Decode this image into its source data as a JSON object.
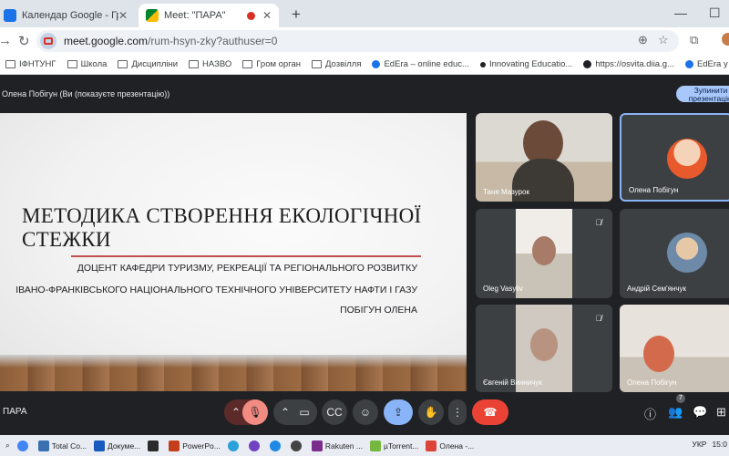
{
  "browser": {
    "tabs": [
      {
        "title": "Календар Google - Графік по",
        "active": false
      },
      {
        "title": "Meet: \"ПАРА\"",
        "active": true
      }
    ],
    "url_domain": "meet.google.com",
    "url_path": "/rum-hsyn-zky?authuser=0",
    "bookmarks": [
      {
        "label": "ІФНТУНГ",
        "type": "folder"
      },
      {
        "label": "Школа",
        "type": "folder"
      },
      {
        "label": "Дисципліни",
        "type": "folder"
      },
      {
        "label": "НАЗВО",
        "type": "folder"
      },
      {
        "label": "Гром орган",
        "type": "folder"
      },
      {
        "label": "Дозвілля",
        "type": "folder"
      },
      {
        "label": "EdEra – online educ...",
        "type": "site",
        "color": "#1a73e8"
      },
      {
        "label": "Innovating Educatio...",
        "type": "site",
        "color": "#202124"
      },
      {
        "label": "https://osvita.diia.g...",
        "type": "site",
        "color": "#202124"
      },
      {
        "label": "EdEra у Viber",
        "type": "site",
        "color": "#1a73e8"
      }
    ]
  },
  "meet": {
    "presenting_label": "Олена Побігун (Ви (показуєте презентацію))",
    "stop_button": "Зупинити презентацію",
    "meeting_name": "ПАРА",
    "people_count": "7",
    "slide": {
      "title_line1": "МЕТОДИКА СТВОРЕННЯ ЕКОЛОГІЧНОЇ",
      "title_line2": "СТЕЖКИ",
      "sub1": "ДОЦЕНТ КАФЕДРИ ТУРИЗМУ, РЕКРЕАЦІЇ ТА РЕГІОНАЛЬНОГО РОЗВИТКУ",
      "sub2": "ІВАНО-ФРАНКІВСЬКОГО НАЦІОНАЛЬНОГО ТЕХНІЧНОГО УНІВЕРСИТЕТУ НАФТИ І ГАЗУ",
      "sub3": "ПОБІГУН ОЛЕНА"
    },
    "participants": [
      {
        "name": "Таня Мазурок",
        "muted": false
      },
      {
        "name": "Олена Побігун",
        "muted": false
      },
      {
        "name": "Oleg Vasyliv",
        "muted": true
      },
      {
        "name": "Андрій Сем'янчук",
        "muted": false
      },
      {
        "name": "Євгеній Винничук",
        "muted": true
      },
      {
        "name": "Олена Побігун",
        "muted": false
      }
    ]
  },
  "taskbar": {
    "items": [
      "Total Co...",
      "Докуме...",
      "PowerPo...",
      "Rakuten ...",
      "µTorrent...",
      "Олена -..."
    ],
    "lang": "УКР",
    "time": "15:0"
  }
}
